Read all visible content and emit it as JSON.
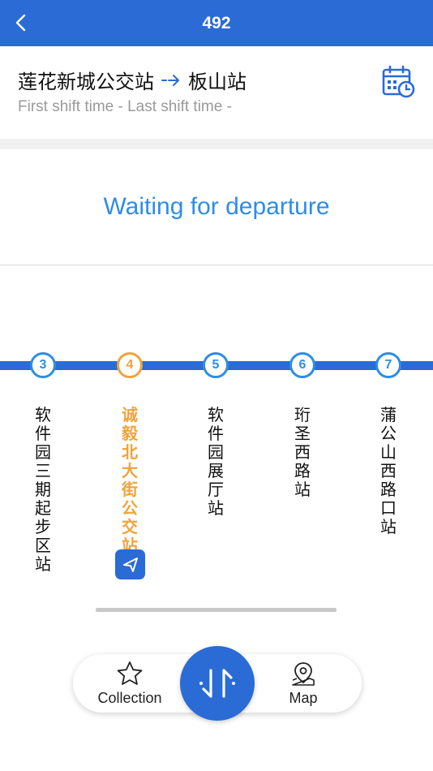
{
  "header": {
    "title": "492",
    "back_icon": "chevron-left-icon"
  },
  "route": {
    "from": "莲花新城公交站",
    "to": "板山站",
    "arrow_icon": "arrow-right-icon",
    "shift_time": "First shift time - Last shift time -",
    "calendar_icon": "calendar-clock-icon"
  },
  "status": {
    "text": "Waiting for departure"
  },
  "stops": [
    {
      "number": "3",
      "name": "软件园三期起步区站",
      "current": false
    },
    {
      "number": "4",
      "name": "诚毅北大街公交站",
      "current": true
    },
    {
      "number": "5",
      "name": "软件园展厅站",
      "current": false
    },
    {
      "number": "6",
      "name": "珩圣西路站",
      "current": false
    },
    {
      "number": "7",
      "name": "蒲公山西路口站",
      "current": false
    }
  ],
  "locate": {
    "icon": "navigation-arrow-icon"
  },
  "bottom_bar": {
    "collection_label": "Collection",
    "collection_icon": "star-icon",
    "swap_icon": "swap-direction-icon",
    "map_label": "Map",
    "map_icon": "map-pin-icon"
  },
  "colors": {
    "brand_blue": "#2a6bd6",
    "stop_blue": "#2d8de8",
    "current_orange": "#f0a33a",
    "muted_text": "#9a9a9a"
  }
}
